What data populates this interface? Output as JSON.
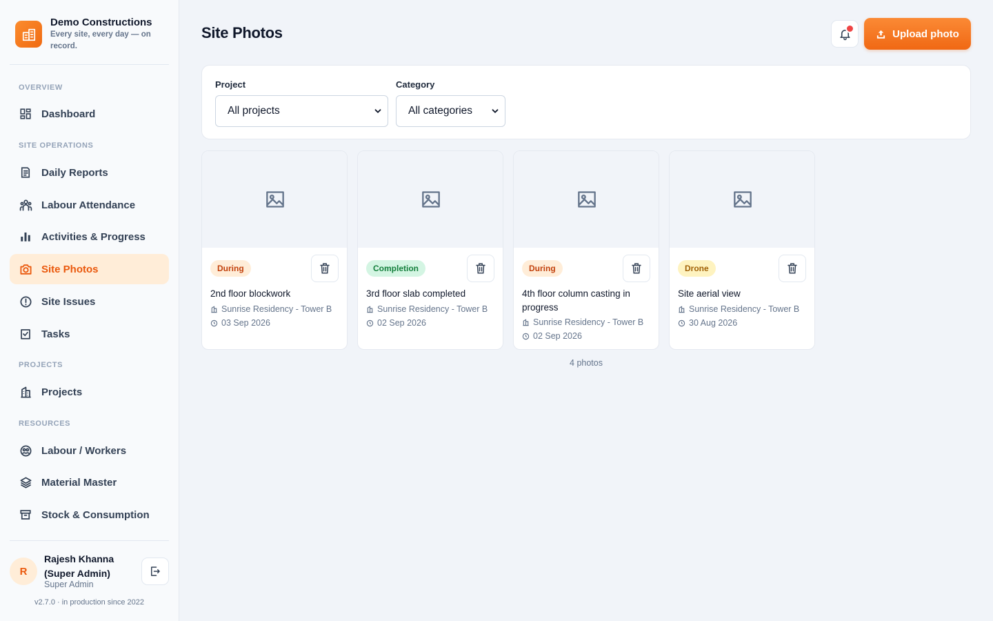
{
  "brand": {
    "name": "Demo Constructions",
    "tagline": "Every site, every day — on record."
  },
  "nav": {
    "sections": [
      {
        "title": "OVERVIEW",
        "items": [
          {
            "label": "Dashboard",
            "icon": "dashboard-icon"
          }
        ]
      },
      {
        "title": "SITE OPERATIONS",
        "items": [
          {
            "label": "Daily Reports",
            "icon": "report-icon"
          },
          {
            "label": "Labour Attendance",
            "icon": "people-icon"
          },
          {
            "label": "Activities & Progress",
            "icon": "bar-chart-icon"
          },
          {
            "label": "Site Photos",
            "icon": "camera-icon",
            "active": true
          },
          {
            "label": "Site Issues",
            "icon": "alert-circle-icon"
          },
          {
            "label": "Tasks",
            "icon": "checkbox-icon"
          }
        ]
      },
      {
        "title": "PROJECTS",
        "items": [
          {
            "label": "Projects",
            "icon": "building-icon"
          }
        ]
      },
      {
        "title": "RESOURCES",
        "items": [
          {
            "label": "Labour / Workers",
            "icon": "workers-icon"
          },
          {
            "label": "Material Master",
            "icon": "layers-icon"
          },
          {
            "label": "Stock & Consumption",
            "icon": "archive-icon"
          }
        ]
      }
    ]
  },
  "user": {
    "initial": "R",
    "name": "Rajesh Khanna (Super Admin)",
    "role": "Super Admin"
  },
  "version": "v2.7.0 · in production since 2022",
  "header": {
    "title": "Site Photos",
    "upload_label": "Upload photo"
  },
  "filters": {
    "project": {
      "label": "Project",
      "value": "All projects"
    },
    "category": {
      "label": "Category",
      "value": "All categories"
    }
  },
  "photos": [
    {
      "badge": "During",
      "badge_type": "during",
      "title": "2nd floor blockwork",
      "project": "Sunrise Residency - Tower B",
      "date": "03 Sep 2026"
    },
    {
      "badge": "Completion",
      "badge_type": "completion",
      "title": "3rd floor slab completed",
      "project": "Sunrise Residency - Tower B",
      "date": "02 Sep 2026"
    },
    {
      "badge": "During",
      "badge_type": "during",
      "title": "4th floor column casting in progress",
      "project": "Sunrise Residency - Tower B",
      "date": "02 Sep 2026"
    },
    {
      "badge": "Drone",
      "badge_type": "drone",
      "title": "Site aerial view",
      "project": "Sunrise Residency - Tower B",
      "date": "30 Aug 2026"
    }
  ],
  "photo_count": "4 photos",
  "colors": {
    "accent": "#f06a12",
    "accent_light": "#ffedd8",
    "text": "#0f172a",
    "muted": "#64748b"
  }
}
